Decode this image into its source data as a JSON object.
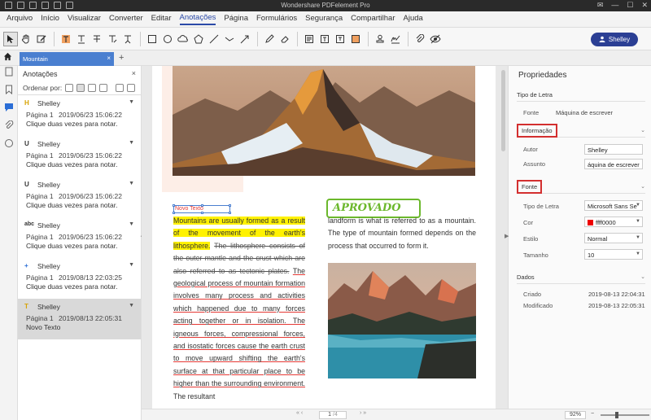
{
  "app": {
    "title": "Wondershare PDFelement Pro",
    "window_controls": [
      "✉",
      "—",
      "☐",
      "✕"
    ]
  },
  "menu": [
    "Arquivo",
    "Início",
    "Visualizar",
    "Converter",
    "Editar",
    "Anotações",
    "Página",
    "Formulários",
    "Segurança",
    "Compartilhar",
    "Ajuda"
  ],
  "menu_active": "Anotações",
  "toolbar": {
    "user_label": "Shelley"
  },
  "tabs": {
    "document": "Mountain",
    "close": "×",
    "add": "+"
  },
  "annotations_panel": {
    "title": "Anotações",
    "close": "×",
    "sort_label": "Ordenar por:",
    "items": [
      {
        "icon": "H",
        "icon_color": "#d7a200",
        "author": "Shelley",
        "page": "Página 1",
        "date": "2019/06/23 15:06:22",
        "text": "Clique duas vezes para notar."
      },
      {
        "icon": "U",
        "icon_color": "#333333",
        "author": "Shelley",
        "page": "Página 1",
        "date": "2019/06/23 15:06:22",
        "text": "Clique duas vezes para notar."
      },
      {
        "icon": "U",
        "icon_color": "#333333",
        "author": "Shelley",
        "page": "Página 1",
        "date": "2019/06/23 15:06:22",
        "text": "Clique duas vezes para notar."
      },
      {
        "icon": "abc",
        "icon_color": "#333333",
        "author": "Shelley",
        "page": "Página 1",
        "date": "2019/06/23 15:06:22",
        "text": "Clique duas vezes para notar."
      },
      {
        "icon": "+",
        "icon_color": "#2b6ed6",
        "author": "Shelley",
        "page": "Página 1",
        "date": "2019/08/13 22:03:25",
        "text": "Clique duas vezes para notar."
      },
      {
        "icon": "T",
        "icon_color": "#d7a200",
        "author": "Shelley",
        "page": "Página 1",
        "date": "2019/08/13 22:05:31",
        "text": "Novo Texto"
      }
    ]
  },
  "document": {
    "textbox_label": "Novo Texto",
    "stamp": "APROVADO",
    "left_highlight": "Mountains are usually formed as a result of the movement of the earth's lithosphere.",
    "left_strike": "The lithosphere consists of the outer mantle and the crust which are also referred to as tectonic plates.",
    "left_underline": "The geological process of mountain formation involves many process and activities which happened due to many forces acting together or in isolation. The igneous forces, compressional forces, and isostatic forces cause the earth crust to move upward shifting the earth's surface at that particular place to be higher than the surrounding environment.",
    "left_tail": "The resultant",
    "right_text": "landform is what is referred to as a mountain. The type of mountain formed depends on the process that occurred to form it."
  },
  "pager": {
    "current": "1",
    "total": "/4",
    "zoom": "92%"
  },
  "properties": {
    "title": "Propriedades",
    "font_section": "Tipo de Letra",
    "font_label": "Fonte",
    "font_value": "Máquina de escrever",
    "info_section": "Informação",
    "author_label": "Autor",
    "author_value": "Shelley",
    "subject_label": "Assunto",
    "subject_value": "áquina de escrever",
    "fonte_section": "Fonte",
    "typeface_label": "Tipo de Letra",
    "typeface_value": "Microsoft Sans Se",
    "color_label": "Cor",
    "color_value": "ffff0000",
    "style_label": "Estilo",
    "style_value": "Normal",
    "size_label": "Tamanho",
    "size_value": "10",
    "data_section": "Dados",
    "created_label": "Criado",
    "created_value": "2019-08-13 22:04:31",
    "modified_label": "Modificado",
    "modified_value": "2019-08-13 22:05:31"
  }
}
